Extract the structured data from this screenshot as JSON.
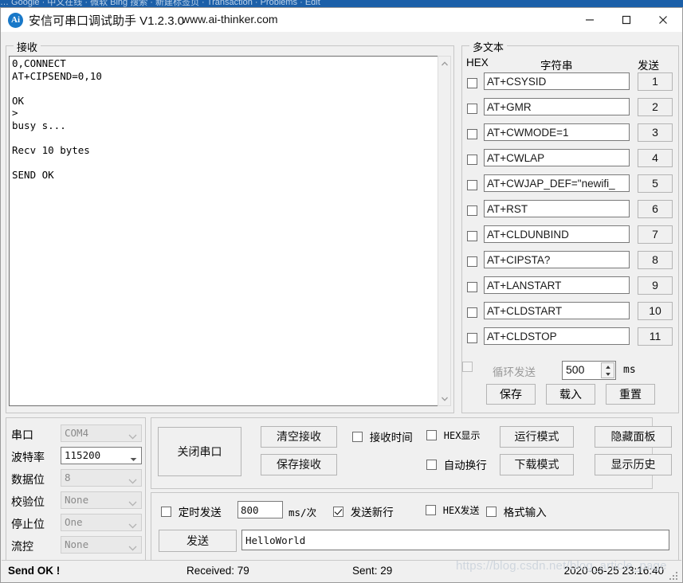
{
  "background_window": {
    "tabs_text": "…  Google  ·  中文在线  ·  微软 Bing 搜索  ·  新建标签页  ·  Transaction  ·  Problems  ·  Edit"
  },
  "titlebar": {
    "app_title": "安信可串口调试助手 V1.2.3.0",
    "url": "www.ai-thinker.com",
    "icon_text": "Ai",
    "minimize": "minimize-icon",
    "maximize": "maximize-icon",
    "close": "close-icon"
  },
  "receive": {
    "group_label": "接收",
    "content": "0,CONNECT\nAT+CIPSEND=0,10\n\nOK\n>\nbusy s...\n\nRecv 10 bytes\n\nSEND OK\n"
  },
  "multitext": {
    "group_label": "多文本",
    "col_hex": "HEX",
    "col_string": "字符串",
    "col_send": "发送",
    "rows": [
      {
        "hex_checked": false,
        "command": "AT+CSYSID",
        "send_label": "1"
      },
      {
        "hex_checked": false,
        "command": "AT+GMR",
        "send_label": "2"
      },
      {
        "hex_checked": false,
        "command": "AT+CWMODE=1",
        "send_label": "3"
      },
      {
        "hex_checked": false,
        "command": "AT+CWLAP",
        "send_label": "4"
      },
      {
        "hex_checked": false,
        "command": "AT+CWJAP_DEF=\"newifi_",
        "send_label": "5"
      },
      {
        "hex_checked": false,
        "command": "AT+RST",
        "send_label": "6"
      },
      {
        "hex_checked": false,
        "command": "AT+CLDUNBIND",
        "send_label": "7"
      },
      {
        "hex_checked": false,
        "command": "AT+CIPSTA?",
        "send_label": "8"
      },
      {
        "hex_checked": false,
        "command": "AT+LANSTART",
        "send_label": "9"
      },
      {
        "hex_checked": false,
        "command": "AT+CLDSTART",
        "send_label": "10"
      },
      {
        "hex_checked": false,
        "command": "AT+CLDSTOP",
        "send_label": "11"
      }
    ],
    "cycle_send_label": "循环发送",
    "cycle_send_checked": false,
    "cycle_send_enabled": false,
    "cycle_interval": "500",
    "cycle_unit": "ms",
    "save_label": "保存",
    "load_label": "载入",
    "reset_label": "重置"
  },
  "serial_settings": {
    "rows": [
      {
        "label": "串口",
        "value": "COM4",
        "enabled": false
      },
      {
        "label": "波特率",
        "value": "115200",
        "enabled": true
      },
      {
        "label": "数据位",
        "value": "8",
        "enabled": false
      },
      {
        "label": "校验位",
        "value": "None",
        "enabled": false
      },
      {
        "label": "停止位",
        "value": "One",
        "enabled": false
      },
      {
        "label": "流控",
        "value": "None",
        "enabled": false
      }
    ]
  },
  "controls": {
    "close_port_label": "关闭串口",
    "clear_recv_label": "清空接收",
    "save_recv_label": "保存接收",
    "recv_time_label": "接收时间",
    "recv_time_checked": false,
    "hex_display_label": "HEX显示",
    "hex_display_checked": false,
    "auto_newline_label": "自动换行",
    "auto_newline_checked": false,
    "run_mode_label": "运行模式",
    "download_mode_label": "下载模式",
    "hide_panel_label": "隐藏面板",
    "show_history_label": "显示历史"
  },
  "send_area": {
    "timed_send_label": "定时发送",
    "timed_send_checked": false,
    "interval_value": "800",
    "interval_unit": "ms/次",
    "send_newline_label": "发送新行",
    "send_newline_checked": true,
    "hex_send_label": "HEX发送",
    "hex_send_checked": false,
    "format_input_label": "格式输入",
    "format_input_checked": false,
    "send_button_label": "发送",
    "send_text": "HelloWorld"
  },
  "statusbar": {
    "status": "Send OK !",
    "received": "Received: 79",
    "sent": "Sent: 29",
    "timestamp": "2020-06-25 23:16:40"
  },
  "watermark": {
    "text": "https://blog.csdn.net/blog_article_page"
  },
  "colors": {
    "window_bg": "#f0f0f0",
    "titlebar_bg": "#ffffff",
    "accent": "#1878c8",
    "field_bg": "#ffffff",
    "border": "#c6c6c6",
    "disabled_text": "#8a8a8a"
  }
}
